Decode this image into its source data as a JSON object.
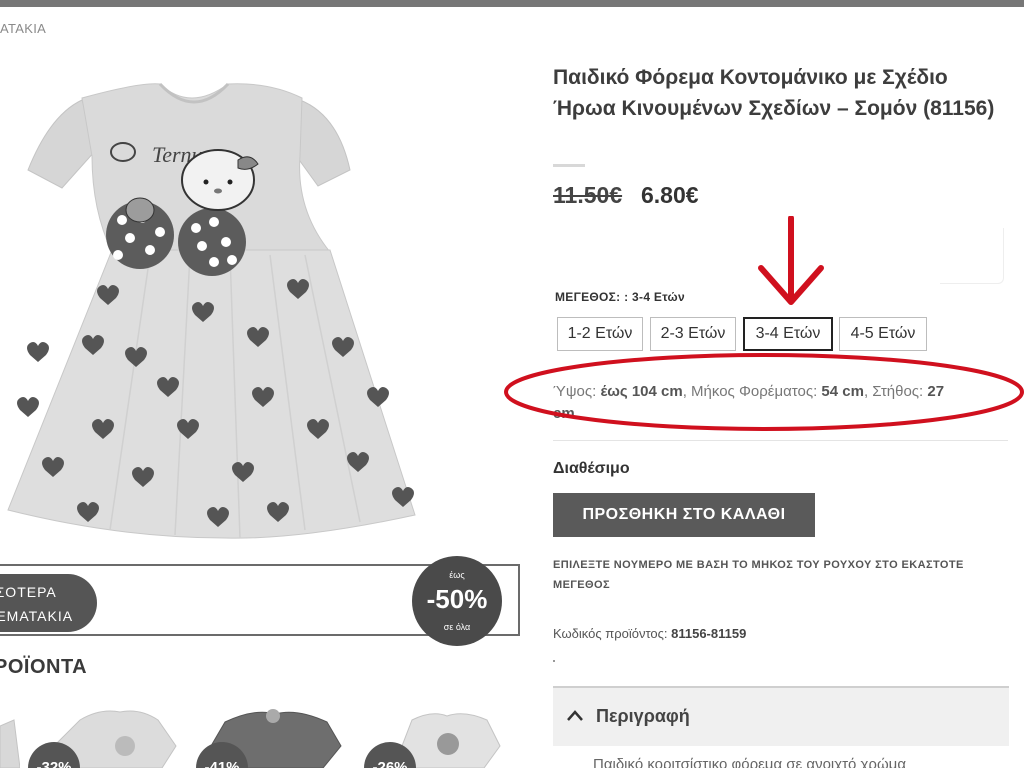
{
  "breadcrumb": "ΑΤΑΚΙΑ",
  "product": {
    "title": "Παιδικό Φόρεμα Κοντομάνικο με Σχέδιο Ήρωα Κινουμένων Σχεδίων – Σομόν (81156)",
    "image_text": "Ternura",
    "old_price": "11.50€",
    "new_price": "6.80€",
    "size_label": "ΜΕΓΕΘΟΣ: : 3-4 Ετών",
    "sizes": [
      {
        "label": "1-2 Ετών",
        "selected": false
      },
      {
        "label": "2-3 Ετών",
        "selected": false
      },
      {
        "label": "3-4 Ετών",
        "selected": true
      },
      {
        "label": "4-5 Ετών",
        "selected": false
      }
    ],
    "spec": {
      "height_label": "Ύψος: ",
      "height_value": "έως 104 cm",
      "length_label": ", Μήκος Φορέματος: ",
      "length_value": "54 cm",
      "chest_label": ", Στήθος: ",
      "chest_value": "27",
      "chest_unit_peek": "cm"
    },
    "availability": "Διαθέσιμο",
    "add_to_cart": "ΠΡΟΣΘΗΚΗ ΣΤΟ ΚΑΛΑΘΙ",
    "size_note": "ΕΠΙΛΕΞΤΕ ΝΟΥΜΕΡΟ ΜΕ ΒΑΣΗ ΤΟ ΜΗΚΟΣ ΤΟΥ ΡΟΥΧΟΥ ΣΤΟ ΕΚΑΣΤΟΤΕ ΜΕΓΕΘΟΣ",
    "sku_label": "Κωδικός προϊόντος: ",
    "sku_value": "81156-81159",
    "description_title": "Περιγραφή",
    "description_peek": "Παιδικό κοριτσίστικο φόρεμα σε ανοιχτό χρώμα"
  },
  "promo": {
    "pill_line1": "ΣΣΟΤΕΡΑ",
    "pill_line2": "ΡΕΜΑΤΑΚΙΑ",
    "upto": "έως",
    "percent": "-50%",
    "on_all": "σε όλα"
  },
  "related": {
    "title": "ΡΟΪΟΝΤΑ",
    "items": [
      {
        "discount": "-32%"
      },
      {
        "discount": "-41%"
      },
      {
        "discount": "-26%"
      }
    ]
  },
  "colors": {
    "annotation_red": "#d0101e",
    "button_dark": "#5a5a5a"
  }
}
